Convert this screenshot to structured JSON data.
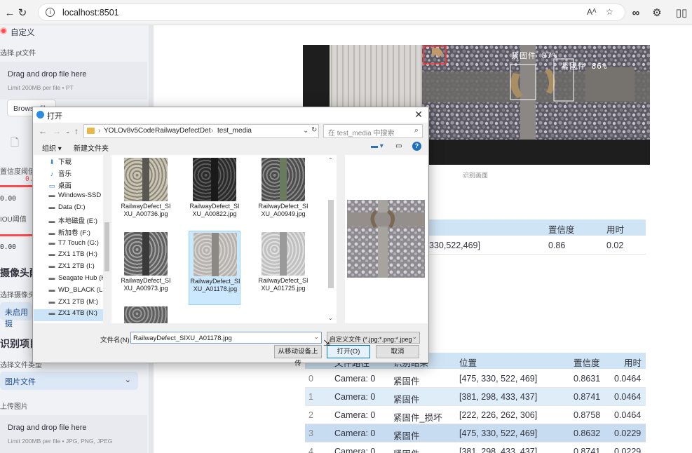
{
  "browser": {
    "url": "localhost:8501"
  },
  "sidebar": {
    "custom_title": "自定义",
    "pt_label": "选择.pt文件",
    "pt_drop_title": "Drag and drop file here",
    "pt_drop_limit": "Limit 200MB per file • PT",
    "browse_label": "Browse files",
    "conf_label": "置信度阈值",
    "conf_value": "0.",
    "conf_min": "0.00",
    "iou_label": "IOU阈值",
    "iou_min": "0.00",
    "iou_min2": "0.00",
    "camera_heading": "摄像头配",
    "camera_select_label": "选择摄像头",
    "camera_select_value": "未启用摄",
    "recog_heading": "识别项目",
    "filetype_label": "选择文件类型",
    "filetype_value": "图片文件",
    "upload_label": "上传图片",
    "img_drop_title": "Drag and drop file here",
    "img_drop_limit": "Limit 200MB per file • JPG, PNG, JPEG"
  },
  "main": {
    "image_caption": "识别画面",
    "overlay_labels": [
      "紧固件 87%",
      "紧固件 86%"
    ],
    "summary_table": {
      "headers": [
        "置信度",
        "用时"
      ],
      "row": {
        "position": "330,522,469]",
        "conf": "0.86",
        "time": "0.02"
      }
    },
    "results_table": {
      "headers": [
        "文件路径",
        "识别结果",
        "位置",
        "置信度",
        "用时"
      ],
      "rows": [
        {
          "idx": "0",
          "path": "Camera: 0",
          "result": "紧固件",
          "pos": "[475, 330, 522, 469]",
          "conf": "0.8631",
          "time": "0.0464"
        },
        {
          "idx": "1",
          "path": "Camera: 0",
          "result": "紧固件",
          "pos": "[381, 298, 433, 437]",
          "conf": "0.8741",
          "time": "0.0464"
        },
        {
          "idx": "2",
          "path": "Camera: 0",
          "result": "紧固件_损坏",
          "pos": "[222, 226, 262, 306]",
          "conf": "0.8758",
          "time": "0.0464"
        },
        {
          "idx": "3",
          "path": "Camera: 0",
          "result": "紧固件",
          "pos": "[475, 330, 522, 469]",
          "conf": "0.8632",
          "time": "0.0229"
        },
        {
          "idx": "4",
          "path": "Camera: 0",
          "result": "紧固件",
          "pos": "[381, 298, 433, 437]",
          "conf": "0.8741",
          "time": "0.0229"
        }
      ]
    }
  },
  "dialog": {
    "title": "打开",
    "path": [
      "YOLOv8v5Code",
      "RailwayDefectDet",
      "test_media"
    ],
    "search_placeholder": "在 test_media 中搜索",
    "organize": "组织 ▾",
    "new_folder": "新建文件夹",
    "nav_items": [
      {
        "icon": "download-icon",
        "label": "下载"
      },
      {
        "icon": "music-icon",
        "label": "音乐"
      },
      {
        "icon": "desktop-icon",
        "label": "桌面"
      },
      {
        "icon": "drive-icon",
        "label": "Windows-SSD (C"
      },
      {
        "icon": "drive-icon",
        "label": "Data (D:)"
      },
      {
        "icon": "drive-icon",
        "label": "本地磁盘 (E:)"
      },
      {
        "icon": "drive-icon",
        "label": "新加卷 (F:)"
      },
      {
        "icon": "drive-icon",
        "label": "T7 Touch (G:)"
      },
      {
        "icon": "drive-icon",
        "label": "ZX1 1TB (H:)"
      },
      {
        "icon": "drive-icon",
        "label": "ZX1 2TB (I:)"
      },
      {
        "icon": "drive-icon",
        "label": "Seagate Hub (K:"
      },
      {
        "icon": "drive-icon",
        "label": "WD_BLACK (L:)"
      },
      {
        "icon": "drive-icon",
        "label": "ZX1 2TB (M:)"
      },
      {
        "icon": "drive-icon",
        "label": "ZX1 4TB (N:)"
      }
    ],
    "files": [
      {
        "name": "RailwayDefect_SIXU_A00736.jpg",
        "selected": false
      },
      {
        "name": "RailwayDefect_SIXU_A00822.jpg",
        "selected": false
      },
      {
        "name": "RailwayDefect_SIXU_A00949.jpg",
        "selected": false
      },
      {
        "name": "RailwayDefect_SIXU_A00973.jpg",
        "selected": false
      },
      {
        "name": "RailwayDefect_SIXU_A01178.jpg",
        "selected": true
      },
      {
        "name": "RailwayDefect_SIXU_A01725.jpg",
        "selected": false
      }
    ],
    "filename_label": "文件名(N):",
    "filename_value": "RailwayDefect_SIXU_A01178.jpg",
    "filter_value": "自定义文件 (*.jpg;*.png;*.jpeg",
    "mobile_upload": "从移动设备上传",
    "open_button": "打开(O)",
    "cancel_button": "取消"
  }
}
